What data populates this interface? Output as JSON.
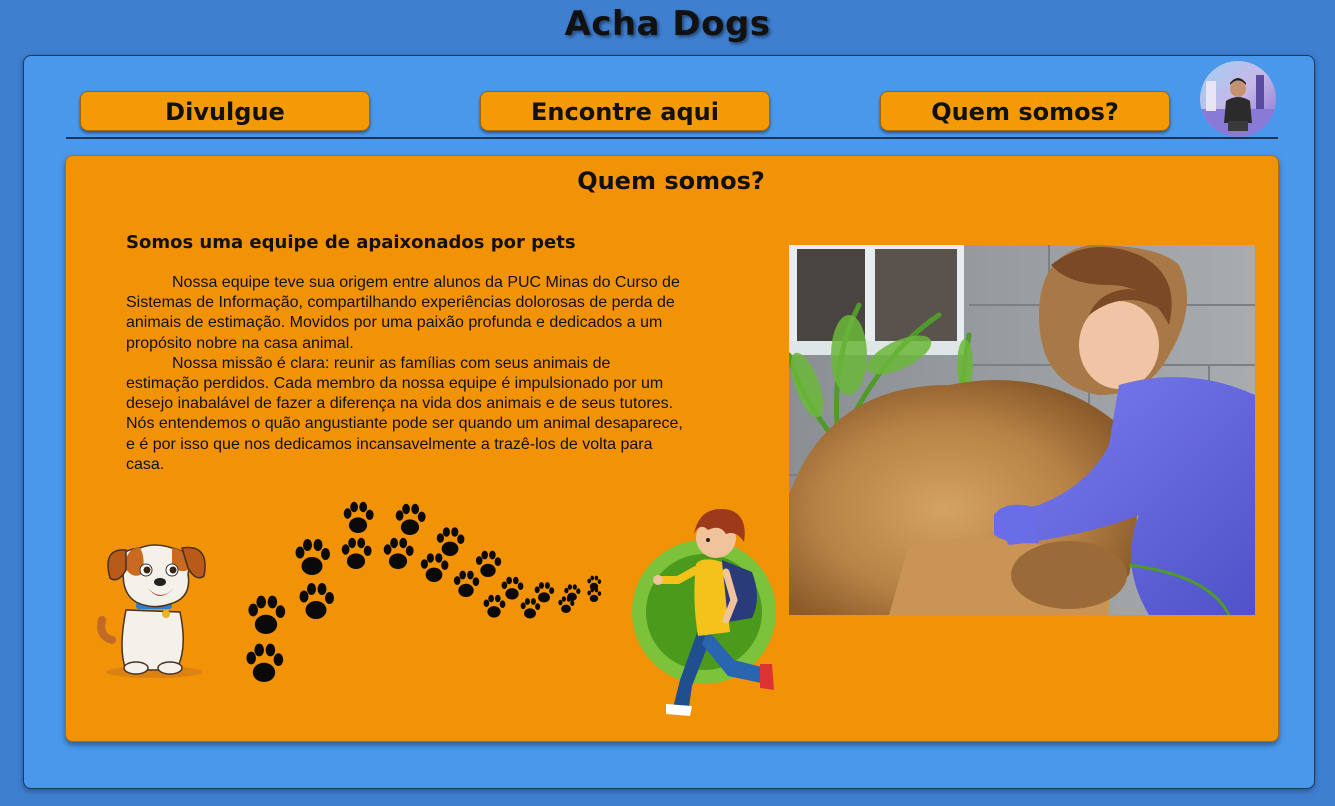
{
  "site": {
    "title": "Acha Dogs"
  },
  "nav": {
    "items": [
      {
        "label": "Divulgue"
      },
      {
        "label": "Encontre aqui"
      },
      {
        "label": "Quem somos?"
      }
    ]
  },
  "about": {
    "title": "Quem somos?",
    "heading": "Somos uma equipe de apaixonados por pets",
    "paragraphs": [
      "Nossa equipe teve sua origem entre alunos da PUC Minas do Curso de Sistemas de Informação, compartilhando experiências dolorosas de perda de animais de estimação. Movidos por uma paixão profunda e dedicados a um propósito nobre na casa animal.",
      "Nossa missão é clara: reunir as famílias com seus animais de estimação perdidos. Cada membro da nossa equipe é impulsionado por um desejo inabalável de fazer a diferença na vida dos animais e de seus tutores. Nós entendemos o quão angustiante pode ser quando um animal desaparece, e é por isso que nos dedicamos incansavelmente a trazê-los de volta para casa."
    ]
  },
  "colors": {
    "background": "#3f7fd0",
    "frame": "#4a98ec",
    "accent": "#f29307",
    "text": "#111111"
  },
  "icons": {
    "avatar": "user-avatar",
    "dog": "cartoon-dog-illustration",
    "paws": "paw-prints-trail-icon",
    "runner": "running-boy-illustration",
    "photo": "boy-hugging-dog-photo"
  }
}
